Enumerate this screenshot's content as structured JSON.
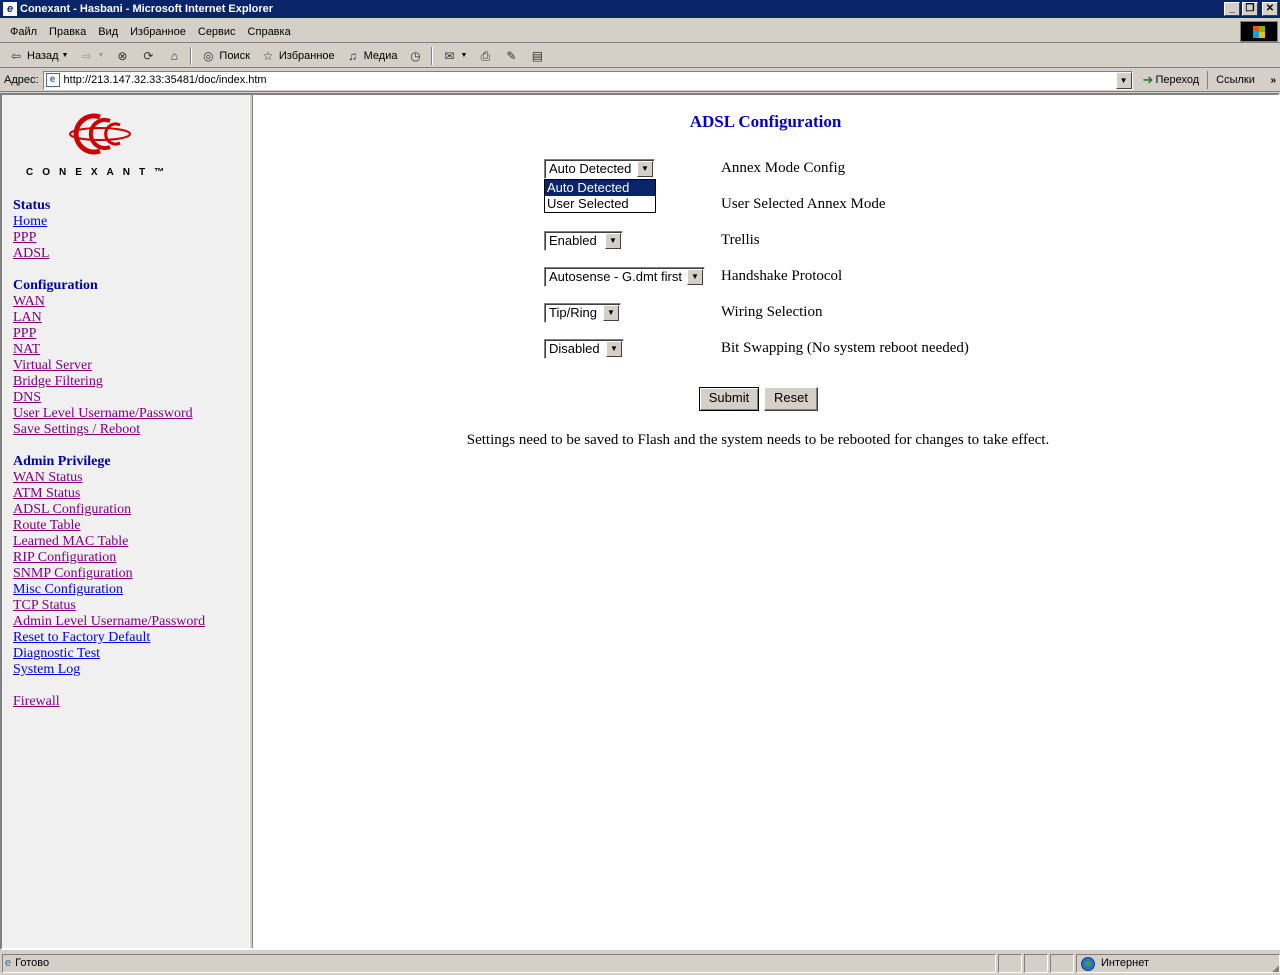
{
  "window": {
    "title": "Conexant - Hasbani - Microsoft Internet Explorer",
    "minimize": "_",
    "maximize": "❐",
    "close": "✕"
  },
  "menu": [
    "Файл",
    "Правка",
    "Вид",
    "Избранное",
    "Сервис",
    "Справка"
  ],
  "toolbar": {
    "back": "Назад",
    "search": "Поиск",
    "favorites": "Избранное",
    "media": "Медиа"
  },
  "address": {
    "label": "Адрес:",
    "url": "http://213.147.32.33:35481/doc/index.htm",
    "go": "Переход",
    "links": "Ссылки",
    "more": "»"
  },
  "logo": {
    "text": "CONEXANT™",
    "color": "#cc0000"
  },
  "nav": {
    "status": {
      "header": "Status",
      "items": [
        "Home",
        "PPP",
        "ADSL"
      ]
    },
    "configuration": {
      "header": "Configuration",
      "items": [
        "WAN",
        "LAN",
        "PPP",
        "NAT",
        "Virtual Server",
        "Bridge Filtering",
        "DNS",
        "User Level Username/Password",
        "Save Settings / Reboot"
      ]
    },
    "admin": {
      "header": "Admin Privilege",
      "items": [
        "WAN Status",
        "ATM Status",
        "ADSL Configuration",
        "Route Table",
        "Learned MAC Table",
        "RIP Configuration",
        "SNMP Configuration",
        "Misc Configuration",
        "TCP Status",
        "Admin Level Username/Password",
        "Reset to Factory Default",
        "Diagnostic Test",
        "System Log"
      ]
    },
    "firewall": "Firewall"
  },
  "page": {
    "title": "ADSL Configuration",
    "rows": [
      {
        "value": "Auto Detected",
        "label": "Annex Mode Config"
      },
      {
        "value": "",
        "label": "User Selected Annex Mode"
      },
      {
        "value": "Enabled",
        "label": "Trellis"
      },
      {
        "value": "Autosense - G.dmt first",
        "label": "Handshake Protocol"
      },
      {
        "value": "Tip/Ring",
        "label": "Wiring Selection"
      },
      {
        "value": "Disabled",
        "label": "Bit Swapping (No system reboot needed)"
      }
    ],
    "dropdown_options": [
      "Auto Detected",
      "User Selected"
    ],
    "submit": "Submit",
    "reset": "Reset",
    "note": "Settings need to be saved to Flash and the system needs to be rebooted for changes to take effect."
  },
  "status": {
    "text": "Готово",
    "zone": "Интернет"
  }
}
